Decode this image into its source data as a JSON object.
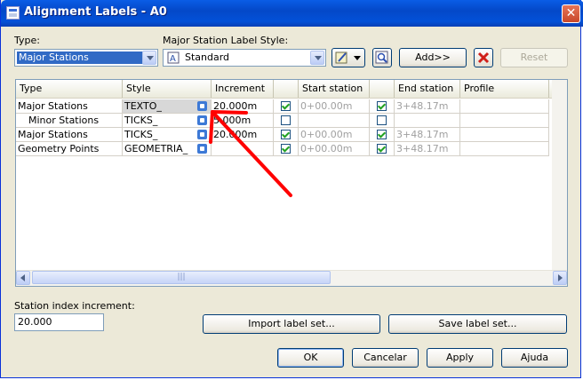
{
  "window": {
    "title": "Alignment Labels - A0",
    "close_glyph": "✕"
  },
  "type_field": {
    "label": "Type:",
    "value": "Major Stations"
  },
  "style_field": {
    "label": "Major Station Label Style:",
    "value": "Standard"
  },
  "buttons": {
    "add": "Add>>",
    "reset": "Reset",
    "import": "Import label set...",
    "save": "Save label set...",
    "ok": "OK",
    "cancel": "Cancelar",
    "apply": "Apply",
    "help": "Ajuda"
  },
  "icons": {
    "edit": "edit-style-icon",
    "preview": "preview-icon",
    "delete": "delete-icon"
  },
  "grid": {
    "columns": [
      "Type",
      "Style",
      "Increment",
      "",
      "Start station",
      "",
      "End station",
      "Profile"
    ],
    "rows": [
      {
        "type": "Major Stations",
        "style": "TEXTO_",
        "increment": "20.000m",
        "start_checked": true,
        "start": "0+00.00m",
        "end_checked": true,
        "end": "3+48.17m",
        "profile": ""
      },
      {
        "type": "Minor Stations",
        "style": "TICKS_",
        "increment": "5.000m",
        "start_checked": false,
        "start": "",
        "end_checked": false,
        "end": "",
        "profile": ""
      },
      {
        "type": "Major Stations",
        "style": "TICKS_",
        "increment": "20.000m",
        "start_checked": true,
        "start": "0+00.00m",
        "end_checked": true,
        "end": "3+48.17m",
        "profile": ""
      },
      {
        "type": "Geometry Points",
        "style": "GEOMETRIA_",
        "increment": "",
        "start_checked": true,
        "start": "0+00.00m",
        "end_checked": true,
        "end": "3+48.17m",
        "profile": ""
      }
    ],
    "scroll_grip": "|||"
  },
  "station_index": {
    "label": "Station index increment:",
    "value": "20.000"
  },
  "annotation": {
    "arrow_color": "#ff0000"
  }
}
